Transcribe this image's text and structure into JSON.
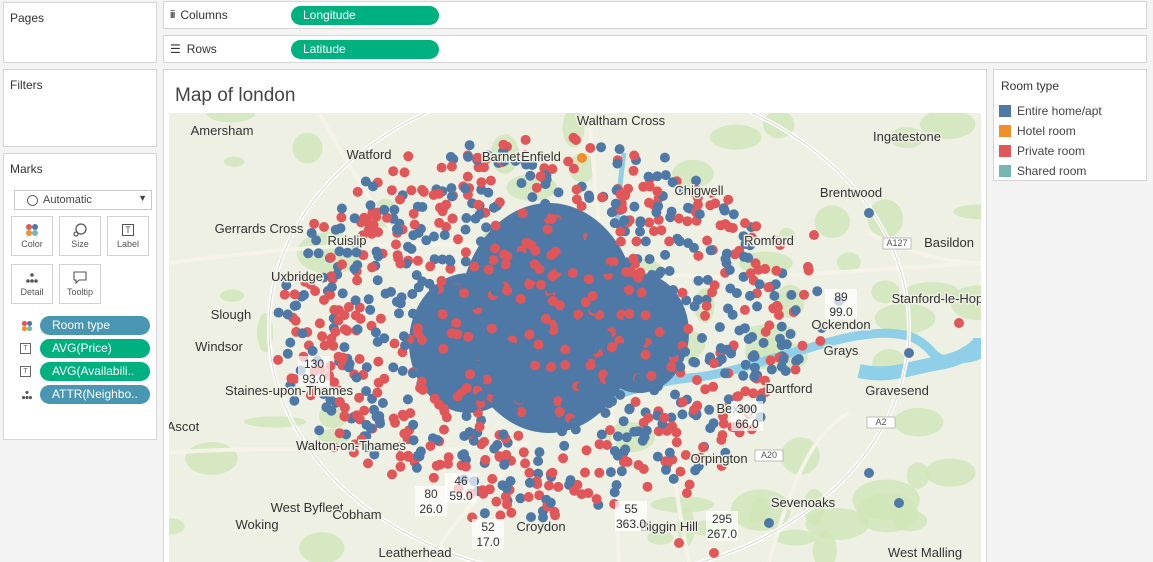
{
  "pages": {
    "title": "Pages"
  },
  "filters": {
    "title": "Filters"
  },
  "marks": {
    "title": "Marks",
    "mark_type": "Automatic",
    "buttons": {
      "color": "Color",
      "size": "Size",
      "label": "Label",
      "detail": "Detail",
      "tooltip": "Tooltip"
    },
    "fields": [
      "Room type",
      "AVG(Price)",
      "AVG(Availabili..",
      "ATTR(Neighbo.."
    ]
  },
  "shelves": {
    "columns_label": "Columns",
    "columns_pill": "Longitude",
    "rows_label": "Rows",
    "rows_pill": "Latitude"
  },
  "view": {
    "title": "Map of london"
  },
  "legend": {
    "title": "Room type",
    "items": [
      {
        "label": "Entire home/apt",
        "color": "#4e79a7"
      },
      {
        "label": "Hotel room",
        "color": "#f28e2b"
      },
      {
        "label": "Private room",
        "color": "#e15759"
      },
      {
        "label": "Shared room",
        "color": "#76b7b2"
      }
    ]
  },
  "map": {
    "places": [
      "Waltham Cross",
      "Amersham",
      "Watford",
      "Ingatestone",
      "Chigwell",
      "Brentwood",
      "Gerrards Cross",
      "Ruislip",
      "Romford",
      "Basildon",
      "Uxbridge",
      "Stanford-le-Hope",
      "Slough",
      "Windsor",
      "Grays",
      "Dartford",
      "Gravesend",
      "Staines-upon-Thames",
      "Ascot",
      "Walton-on-Thames",
      "Orpington",
      "West Byfleet",
      "Cobham",
      "Woking",
      "Leatherhead",
      "West Malling",
      "Croydon",
      "Biggin Hill",
      "Barnet",
      "Enfield",
      "Ockendon",
      "Bexley",
      "Sevenoaks"
    ],
    "roads": [
      "A127",
      "A2",
      "A20"
    ],
    "data_labels": [
      {
        "price": "89",
        "availability": "99.0"
      },
      {
        "price": "130",
        "availability": "93.0"
      },
      {
        "price": "300",
        "availability": "66.0"
      },
      {
        "price": "80",
        "availability": "26.0"
      },
      {
        "price": "46",
        "availability": "59.0"
      },
      {
        "price": "52",
        "availability": "17.0"
      },
      {
        "price": "55",
        "availability": "363.0"
      },
      {
        "price": "295",
        "availability": "267.0"
      }
    ]
  }
}
